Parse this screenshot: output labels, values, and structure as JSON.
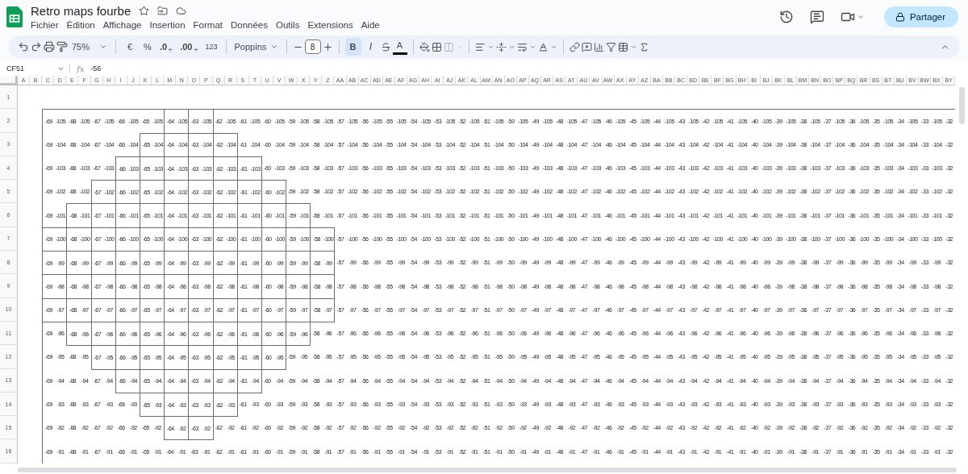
{
  "document": {
    "title": "Retro maps fourbe"
  },
  "menu": [
    "Fichier",
    "Édition",
    "Affichage",
    "Insertion",
    "Format",
    "Données",
    "Outils",
    "Extensions",
    "Aide"
  ],
  "share": {
    "label": "Partager"
  },
  "toolbar": {
    "zoom": "75%",
    "currency": "€",
    "percent": "%",
    "decrease_decimals": ".0",
    "increase_decimals": ".00",
    "number_format": "123",
    "font": "Poppins",
    "font_size": "8",
    "bold": {
      "label": "B",
      "selected": true
    },
    "italic": {
      "label": "I",
      "selected": false
    },
    "text_color": "A",
    "merge_disabled": true
  },
  "formula_bar": {
    "cell": "CF51",
    "fx": "fx",
    "formula": "-56"
  },
  "sheet": {
    "outer_border": true,
    "columns": [
      "A",
      "B",
      "C",
      "D",
      "E",
      "F",
      "G",
      "H",
      "I",
      "J",
      "K",
      "L",
      "M",
      "N",
      "O",
      "P",
      "Q",
      "R",
      "S",
      "T",
      "U",
      "V",
      "W",
      "X",
      "Y",
      "Z",
      "AA",
      "AB",
      "AC",
      "AD",
      "AE",
      "AF",
      "AG",
      "AH",
      "AI",
      "AJ",
      "AK",
      "AL",
      "AM",
      "AN",
      "AO",
      "AP",
      "AQ",
      "AR",
      "AS",
      "AT",
      "AU",
      "AV",
      "AW",
      "AX",
      "AY",
      "AZ",
      "BA",
      "BB",
      "BC",
      "BD",
      "BE",
      "BF",
      "BG",
      "BH",
      "BI",
      "BJ",
      "BK",
      "BL",
      "BM",
      "BN",
      "BO",
      "BP",
      "BQ",
      "BR",
      "BS",
      "BT",
      "BU",
      "BV",
      "BW",
      "BX",
      "BY"
    ],
    "rows": [
      {
        "label": "1"
      },
      {
        "label": "2",
        "cells": [
          "-69",
          "-105",
          "-68",
          "-105",
          "-67",
          "-105",
          "-66",
          "-105",
          "-65",
          "-105",
          "-64",
          "-105",
          "-63",
          "-105",
          "-62",
          "-105",
          "-61",
          "-105",
          "-60",
          "-105",
          "-59",
          "-105",
          "-58",
          "-105",
          "-57",
          "-105",
          "-56",
          "-105",
          "-55",
          "-105",
          "-54",
          "-105",
          "-53",
          "-105",
          "-52",
          "-105",
          "-51",
          "-105",
          "-50",
          "-105",
          "-49",
          "-105",
          "-48",
          "-105",
          "-47",
          "-105",
          "-46",
          "-105",
          "-45",
          "-105",
          "-44",
          "-105",
          "-43",
          "-105",
          "-42",
          "-105",
          "-41",
          "-105",
          "-40",
          "-105",
          "-39",
          "-105",
          "-38",
          "-105",
          "-37",
          "-105",
          "-36",
          "-105",
          "-35",
          "-105",
          "-34",
          "-105",
          "-33",
          "-105",
          "-32"
        ],
        "boxed": [
          false,
          false,
          false,
          false,
          false,
          true,
          true,
          false,
          false,
          false,
          false,
          false,
          false,
          false,
          false,
          false,
          false,
          false,
          false,
          false,
          false,
          false,
          false,
          false,
          false,
          false,
          false,
          false,
          false,
          false,
          false,
          false,
          false,
          false,
          false,
          false,
          false,
          false
        ]
      },
      {
        "label": "3",
        "cells": [
          "-69",
          "-104",
          "-68",
          "-104",
          "-67",
          "-104",
          "-66",
          "-104",
          "-65",
          "-104",
          "-64",
          "-104",
          "-63",
          "-104",
          "-62",
          "-104",
          "-61",
          "-104",
          "-60",
          "-104",
          "-59",
          "-104",
          "-58",
          "-104",
          "-57",
          "-104",
          "-56",
          "-104",
          "-55",
          "-104",
          "-54",
          "-104",
          "-53",
          "-104",
          "-52",
          "-104",
          "-51",
          "-104",
          "-50",
          "-104",
          "-49",
          "-104",
          "-48",
          "-104",
          "-47",
          "-104",
          "-46",
          "-104",
          "-45",
          "-104",
          "-44",
          "-104",
          "-43",
          "-104",
          "-42",
          "-104",
          "-41",
          "-104",
          "-40",
          "-104",
          "-39",
          "-104",
          "-38",
          "-104",
          "-37",
          "-104",
          "-36",
          "-104",
          "-35",
          "-104",
          "-34",
          "-104",
          "-33",
          "-104",
          "-32"
        ],
        "boxed": [
          false,
          false,
          false,
          false,
          true,
          true,
          true,
          true,
          false,
          false,
          false,
          false,
          false,
          false,
          false,
          false,
          false,
          false,
          false,
          false,
          false,
          false,
          false,
          false,
          false,
          false,
          false,
          false,
          false,
          false,
          false,
          false,
          false,
          false,
          false,
          false,
          false,
          false
        ]
      },
      {
        "label": "4",
        "cells": [
          "-69",
          "-103",
          "-68",
          "-103",
          "-67",
          "-103",
          "-66",
          "-103",
          "-65",
          "-103",
          "-64",
          "-103",
          "-63",
          "-103",
          "-62",
          "-103",
          "-61",
          "-103",
          "-60",
          "-103",
          "-59",
          "-103",
          "-58",
          "-103",
          "-57",
          "-103",
          "-56",
          "-103",
          "-55",
          "-103",
          "-54",
          "-103",
          "-53",
          "-103",
          "-52",
          "-103",
          "-51",
          "-103",
          "-50",
          "-103",
          "-49",
          "-103",
          "-48",
          "-103",
          "-47",
          "-103",
          "-46",
          "-103",
          "-45",
          "-103",
          "-44",
          "-103",
          "-43",
          "-103",
          "-42",
          "-103",
          "-41",
          "-103",
          "-40",
          "-103",
          "-39",
          "-103",
          "-38",
          "-103",
          "-37",
          "-103",
          "-36",
          "-103",
          "-35",
          "-103",
          "-34",
          "-103",
          "-33",
          "-103",
          "-32"
        ],
        "boxed": [
          false,
          false,
          false,
          true,
          true,
          true,
          true,
          true,
          true,
          false,
          false,
          false,
          false,
          false,
          false,
          false,
          false,
          false,
          false,
          false,
          false,
          false,
          false,
          false,
          false,
          false,
          false,
          false,
          false,
          false,
          false,
          false,
          false,
          false,
          false,
          false,
          false,
          false
        ]
      },
      {
        "label": "5",
        "cells": [
          "-69",
          "-102",
          "-68",
          "-102",
          "-67",
          "-102",
          "-66",
          "-102",
          "-65",
          "-102",
          "-64",
          "-102",
          "-63",
          "-102",
          "-62",
          "-102",
          "-61",
          "-102",
          "-60",
          "-102",
          "-59",
          "-102",
          "-58",
          "-102",
          "-57",
          "-102",
          "-56",
          "-102",
          "-55",
          "-102",
          "-54",
          "-102",
          "-53",
          "-102",
          "-52",
          "-102",
          "-51",
          "-102",
          "-50",
          "-102",
          "-49",
          "-102",
          "-48",
          "-102",
          "-47",
          "-102",
          "-46",
          "-102",
          "-45",
          "-102",
          "-44",
          "-102",
          "-43",
          "-102",
          "-42",
          "-102",
          "-41",
          "-102",
          "-40",
          "-102",
          "-39",
          "-102",
          "-38",
          "-102",
          "-37",
          "-102",
          "-36",
          "-102",
          "-35",
          "-102",
          "-34",
          "-102",
          "-33",
          "-102",
          "-32"
        ],
        "boxed": [
          false,
          false,
          true,
          true,
          true,
          true,
          true,
          true,
          true,
          true,
          false,
          false,
          false,
          false,
          false,
          false,
          false,
          false,
          false,
          false,
          false,
          false,
          false,
          false,
          false,
          false,
          false,
          false,
          false,
          false,
          false,
          false,
          false,
          false,
          false,
          false,
          false,
          false
        ]
      },
      {
        "label": "6",
        "cells": [
          "-69",
          "-101",
          "-68",
          "-101",
          "-67",
          "-101",
          "-66",
          "-101",
          "-65",
          "-101",
          "-64",
          "-101",
          "-63",
          "-101",
          "-62",
          "-101",
          "-61",
          "-101",
          "-60",
          "-101",
          "-59",
          "-101",
          "-58",
          "-101",
          "-57",
          "-101",
          "-56",
          "-101",
          "-55",
          "-101",
          "-54",
          "-101",
          "-53",
          "-101",
          "-52",
          "-101",
          "-51",
          "-101",
          "-50",
          "-101",
          "-49",
          "-101",
          "-48",
          "-101",
          "-47",
          "-101",
          "-46",
          "-101",
          "-45",
          "-101",
          "-44",
          "-101",
          "-43",
          "-101",
          "-42",
          "-101",
          "-41",
          "-101",
          "-40",
          "-101",
          "-39",
          "-101",
          "-38",
          "-101",
          "-37",
          "-101",
          "-36",
          "-101",
          "-35",
          "-101",
          "-34",
          "-101",
          "-33",
          "-101",
          "-32"
        ],
        "boxed": [
          false,
          true,
          true,
          true,
          true,
          true,
          true,
          true,
          true,
          true,
          true,
          false,
          false,
          false,
          false,
          false,
          false,
          false,
          false,
          false,
          false,
          false,
          false,
          false,
          false,
          false,
          false,
          false,
          false,
          false,
          false,
          false,
          false,
          false,
          false,
          false,
          false,
          false
        ]
      },
      {
        "label": "7",
        "cells": [
          "-69",
          "-100",
          "-68",
          "-100",
          "-67",
          "-100",
          "-66",
          "-100",
          "-65",
          "-100",
          "-64",
          "-100",
          "-63",
          "-100",
          "-62",
          "-100",
          "-61",
          "-100",
          "-60",
          "-100",
          "-59",
          "-100",
          "-58",
          "-100",
          "-57",
          "-100",
          "-56",
          "-100",
          "-55",
          "-100",
          "-54",
          "-100",
          "-53",
          "-100",
          "-52",
          "-100",
          "-51",
          "-100",
          "-50",
          "-100",
          "-49",
          "-100",
          "-48",
          "-100",
          "-47",
          "-100",
          "-46",
          "-100",
          "-45",
          "-100",
          "-44",
          "-100",
          "-43",
          "-100",
          "-42",
          "-100",
          "-41",
          "-100",
          "-40",
          "-100",
          "-39",
          "-100",
          "-38",
          "-100",
          "-37",
          "-100",
          "-36",
          "-100",
          "-35",
          "-100",
          "-34",
          "-100",
          "-33",
          "-100",
          "-32"
        ],
        "boxed": [
          true,
          true,
          true,
          true,
          true,
          true,
          true,
          true,
          true,
          true,
          true,
          true,
          false,
          false,
          false,
          false,
          false,
          false,
          false,
          false,
          false,
          false,
          false,
          false,
          false,
          false,
          false,
          false,
          false,
          false,
          false,
          false,
          false,
          false,
          false,
          false,
          false,
          false
        ]
      },
      {
        "label": "8",
        "cells": [
          "-69",
          "-99",
          "-68",
          "-99",
          "-67",
          "-99",
          "-66",
          "-99",
          "-65",
          "-99",
          "-64",
          "-99",
          "-63",
          "-99",
          "-62",
          "-99",
          "-61",
          "-99",
          "-60",
          "-99",
          "-59",
          "-99",
          "-58",
          "-99",
          "-57",
          "-99",
          "-56",
          "-99",
          "-55",
          "-99",
          "-54",
          "-99",
          "-53",
          "-99",
          "-52",
          "-99",
          "-51",
          "-99",
          "-50",
          "-99",
          "-49",
          "-99",
          "-48",
          "-99",
          "-47",
          "-99",
          "-46",
          "-99",
          "-45",
          "-99",
          "-44",
          "-99",
          "-43",
          "-99",
          "-42",
          "-99",
          "-41",
          "-99",
          "-40",
          "-99",
          "-39",
          "-99",
          "-38",
          "-99",
          "-37",
          "-99",
          "-36",
          "-99",
          "-35",
          "-99",
          "-34",
          "-99",
          "-33",
          "-99",
          "-32"
        ],
        "boxed": [
          true,
          true,
          true,
          true,
          true,
          true,
          true,
          true,
          true,
          true,
          true,
          true,
          false,
          false,
          false,
          false,
          false,
          false,
          false,
          false,
          false,
          false,
          false,
          false,
          false,
          false,
          false,
          false,
          false,
          false,
          false,
          false,
          false,
          false,
          false,
          false,
          false,
          false
        ]
      },
      {
        "label": "9",
        "cells": [
          "-69",
          "-98",
          "-68",
          "-98",
          "-67",
          "-98",
          "-66",
          "-98",
          "-65",
          "-98",
          "-64",
          "-98",
          "-63",
          "-98",
          "-62",
          "-98",
          "-61",
          "-98",
          "-60",
          "-98",
          "-59",
          "-98",
          "-58",
          "-98",
          "-57",
          "-98",
          "-56",
          "-98",
          "-55",
          "-98",
          "-54",
          "-98",
          "-53",
          "-98",
          "-52",
          "-98",
          "-51",
          "-98",
          "-50",
          "-98",
          "-49",
          "-98",
          "-48",
          "-98",
          "-47",
          "-98",
          "-46",
          "-98",
          "-45",
          "-98",
          "-44",
          "-98",
          "-43",
          "-98",
          "-42",
          "-98",
          "-41",
          "-98",
          "-40",
          "-98",
          "-39",
          "-98",
          "-38",
          "-98",
          "-37",
          "-98",
          "-36",
          "-98",
          "-35",
          "-98",
          "-34",
          "-98",
          "-33",
          "-98",
          "-32"
        ],
        "boxed": [
          true,
          true,
          true,
          true,
          true,
          true,
          true,
          true,
          true,
          true,
          true,
          true,
          false,
          false,
          false,
          false,
          false,
          false,
          false,
          false,
          false,
          false,
          false,
          false,
          false,
          false,
          false,
          false,
          false,
          false,
          false,
          false,
          false,
          false,
          false,
          false,
          false,
          false
        ]
      },
      {
        "label": "10",
        "cells": [
          "-69",
          "-97",
          "-68",
          "-97",
          "-67",
          "-97",
          "-66",
          "-97",
          "-65",
          "-97",
          "-64",
          "-97",
          "-63",
          "-97",
          "-62",
          "-97",
          "-61",
          "-97",
          "-60",
          "-97",
          "-59",
          "-97",
          "-58",
          "-97",
          "-57",
          "-97",
          "-56",
          "-97",
          "-55",
          "-97",
          "-54",
          "-97",
          "-53",
          "-97",
          "-52",
          "-97",
          "-51",
          "-97",
          "-50",
          "-97",
          "-49",
          "-97",
          "-48",
          "-97",
          "-47",
          "-97",
          "-46",
          "-97",
          "-45",
          "-97",
          "-44",
          "-97",
          "-43",
          "-97",
          "-42",
          "-97",
          "-41",
          "-97",
          "-40",
          "-97",
          "-39",
          "-97",
          "-38",
          "-97",
          "-37",
          "-97",
          "-36",
          "-97",
          "-35",
          "-97",
          "-34",
          "-97",
          "-33",
          "-97",
          "-32"
        ],
        "boxed": [
          true,
          true,
          true,
          true,
          true,
          true,
          true,
          true,
          true,
          true,
          true,
          true,
          false,
          false,
          false,
          false,
          false,
          false,
          false,
          false,
          false,
          false,
          false,
          false,
          false,
          false,
          false,
          false,
          false,
          false,
          false,
          false,
          false,
          false,
          false,
          false,
          false,
          false
        ]
      },
      {
        "label": "11",
        "cells": [
          "-69",
          "-96",
          "-68",
          "-96",
          "-67",
          "-96",
          "-66",
          "-96",
          "-65",
          "-96",
          "-64",
          "-96",
          "-63",
          "-96",
          "-62",
          "-96",
          "-61",
          "-96",
          "-60",
          "-96",
          "-59",
          "-96",
          "-58",
          "-96",
          "-57",
          "-96",
          "-56",
          "-96",
          "-55",
          "-96",
          "-54",
          "-96",
          "-53",
          "-96",
          "-52",
          "-96",
          "-51",
          "-96",
          "-50",
          "-96",
          "-49",
          "-96",
          "-48",
          "-96",
          "-47",
          "-96",
          "-46",
          "-96",
          "-45",
          "-96",
          "-44",
          "-96",
          "-43",
          "-96",
          "-42",
          "-96",
          "-41",
          "-96",
          "-40",
          "-96",
          "-39",
          "-96",
          "-38",
          "-96",
          "-37",
          "-96",
          "-36",
          "-96",
          "-35",
          "-96",
          "-34",
          "-96",
          "-33",
          "-96",
          "-32"
        ],
        "boxed": [
          false,
          true,
          true,
          true,
          true,
          true,
          true,
          true,
          true,
          true,
          true,
          false,
          false,
          false,
          false,
          false,
          false,
          false,
          false,
          false,
          false,
          false,
          false,
          false,
          false,
          false,
          false,
          false,
          false,
          false,
          false,
          false,
          false,
          false,
          false,
          false,
          false,
          false
        ]
      },
      {
        "label": "12",
        "cells": [
          "-69",
          "-95",
          "-68",
          "-95",
          "-67",
          "-95",
          "-66",
          "-95",
          "-65",
          "-95",
          "-64",
          "-95",
          "-63",
          "-95",
          "-62",
          "-95",
          "-61",
          "-95",
          "-60",
          "-95",
          "-59",
          "-95",
          "-58",
          "-95",
          "-57",
          "-95",
          "-56",
          "-95",
          "-55",
          "-95",
          "-54",
          "-95",
          "-53",
          "-95",
          "-52",
          "-95",
          "-51",
          "-95",
          "-50",
          "-95",
          "-49",
          "-95",
          "-48",
          "-95",
          "-47",
          "-95",
          "-46",
          "-95",
          "-45",
          "-95",
          "-44",
          "-95",
          "-43",
          "-95",
          "-42",
          "-95",
          "-41",
          "-95",
          "-40",
          "-95",
          "-39",
          "-95",
          "-38",
          "-95",
          "-37",
          "-95",
          "-36",
          "-95",
          "-35",
          "-95",
          "-34",
          "-95",
          "-33",
          "-95",
          "-32"
        ],
        "boxed": [
          false,
          false,
          true,
          true,
          true,
          true,
          true,
          true,
          true,
          true,
          false,
          false,
          false,
          false,
          false,
          false,
          false,
          false,
          false,
          false,
          false,
          false,
          false,
          false,
          false,
          false,
          false,
          false,
          false,
          false,
          false,
          false,
          false,
          false,
          false,
          false,
          false,
          false
        ]
      },
      {
        "label": "13",
        "cells": [
          "-69",
          "-94",
          "-68",
          "-94",
          "-67",
          "-94",
          "-66",
          "-94",
          "-65",
          "-94",
          "-64",
          "-94",
          "-63",
          "-94",
          "-62",
          "-94",
          "-61",
          "-94",
          "-60",
          "-94",
          "-59",
          "-94",
          "-58",
          "-94",
          "-57",
          "-94",
          "-56",
          "-94",
          "-55",
          "-94",
          "-54",
          "-94",
          "-53",
          "-94",
          "-52",
          "-94",
          "-51",
          "-94",
          "-50",
          "-94",
          "-49",
          "-94",
          "-48",
          "-94",
          "-47",
          "-94",
          "-46",
          "-94",
          "-45",
          "-94",
          "-44",
          "-94",
          "-43",
          "-94",
          "-42",
          "-94",
          "-41",
          "-94",
          "-40",
          "-94",
          "-39",
          "-94",
          "-38",
          "-94",
          "-37",
          "-94",
          "-36",
          "-94",
          "-35",
          "-94",
          "-34",
          "-94",
          "-33",
          "-94",
          "-32"
        ],
        "boxed": [
          false,
          false,
          false,
          true,
          true,
          true,
          true,
          true,
          true,
          false,
          false,
          false,
          false,
          false,
          false,
          false,
          false,
          false,
          false,
          false,
          false,
          false,
          false,
          false,
          false,
          false,
          false,
          false,
          false,
          false,
          false,
          false,
          false,
          false,
          false,
          false,
          false,
          false
        ]
      },
      {
        "label": "14",
        "cells": [
          "-69",
          "-93",
          "-68",
          "-93",
          "-67",
          "-93",
          "-66",
          "-93",
          "-65",
          "-93",
          "-64",
          "-93",
          "-63",
          "-93",
          "-62",
          "-93",
          "-61",
          "-93",
          "-60",
          "-93",
          "-59",
          "-93",
          "-58",
          "-93",
          "-57",
          "-93",
          "-56",
          "-93",
          "-55",
          "-93",
          "-54",
          "-93",
          "-53",
          "-93",
          "-52",
          "-93",
          "-51",
          "-93",
          "-50",
          "-93",
          "-49",
          "-93",
          "-48",
          "-93",
          "-47",
          "-93",
          "-46",
          "-93",
          "-45",
          "-93",
          "-44",
          "-93",
          "-43",
          "-93",
          "-42",
          "-93",
          "-41",
          "-93",
          "-40",
          "-93",
          "-39",
          "-93",
          "-38",
          "-93",
          "-37",
          "-93",
          "-36",
          "-93",
          "-35",
          "-93",
          "-34",
          "-93",
          "-33",
          "-93",
          "-32"
        ],
        "boxed": [
          false,
          false,
          false,
          false,
          true,
          true,
          true,
          true,
          false,
          false,
          false,
          false,
          false,
          false,
          false,
          false,
          false,
          false,
          false,
          false,
          false,
          false,
          false,
          false,
          false,
          false,
          false,
          false,
          false,
          false,
          false,
          false,
          false,
          false,
          false,
          false,
          false,
          false
        ]
      },
      {
        "label": "15",
        "cells": [
          "-69",
          "-92",
          "-68",
          "-92",
          "-67",
          "-92",
          "-66",
          "-92",
          "-65",
          "-92",
          "-64",
          "-92",
          "-63",
          "-92",
          "-62",
          "-92",
          "-61",
          "-92",
          "-60",
          "-92",
          "-59",
          "-92",
          "-58",
          "-92",
          "-57",
          "-92",
          "-56",
          "-92",
          "-55",
          "-92",
          "-54",
          "-92",
          "-53",
          "-92",
          "-52",
          "-92",
          "-51",
          "-92",
          "-50",
          "-92",
          "-49",
          "-92",
          "-48",
          "-92",
          "-47",
          "-92",
          "-46",
          "-92",
          "-45",
          "-92",
          "-44",
          "-92",
          "-43",
          "-92",
          "-42",
          "-92",
          "-41",
          "-92",
          "-40",
          "-92",
          "-39",
          "-92",
          "-38",
          "-92",
          "-37",
          "-92",
          "-36",
          "-92",
          "-35",
          "-92",
          "-34",
          "-92",
          "-33",
          "-92",
          "-32"
        ],
        "boxed": [
          false,
          false,
          false,
          false,
          false,
          true,
          true,
          false,
          false,
          false,
          false,
          false,
          false,
          false,
          false,
          false,
          false,
          false,
          false,
          false,
          false,
          false,
          false,
          false,
          false,
          false,
          false,
          false,
          false,
          false,
          false,
          false,
          false,
          false,
          false,
          false,
          false,
          false
        ]
      },
      {
        "label": "16",
        "cells": [
          "-69",
          "-91",
          "-68",
          "-91",
          "-67",
          "-91",
          "-66",
          "-91",
          "-65",
          "-91",
          "-64",
          "-91",
          "-63",
          "-91",
          "-62",
          "-91",
          "-61",
          "-91",
          "-60",
          "-91",
          "-59",
          "-91",
          "-58",
          "-91",
          "-57",
          "-91",
          "-56",
          "-91",
          "-55",
          "-91",
          "-54",
          "-91",
          "-53",
          "-91",
          "-52",
          "-91",
          "-51",
          "-91",
          "-50",
          "-91",
          "-49",
          "-91",
          "-48",
          "-91",
          "-47",
          "-91",
          "-46",
          "-91",
          "-45",
          "-91",
          "-44",
          "-91",
          "-43",
          "-91",
          "-42",
          "-91",
          "-41",
          "-91",
          "-40",
          "-91",
          "-39",
          "-91",
          "-38",
          "-91",
          "-37",
          "-91",
          "-36",
          "-91",
          "-35",
          "-91",
          "-34",
          "-91",
          "-33",
          "-91",
          "-32"
        ],
        "boxed": [
          false,
          false,
          false,
          false,
          false,
          false,
          false,
          false,
          false,
          false,
          false,
          false,
          false,
          false,
          false,
          false,
          false,
          false,
          false,
          false,
          false,
          false,
          false,
          false,
          false,
          false,
          false,
          false,
          false,
          false,
          false,
          false,
          false,
          false,
          false,
          false,
          false,
          false
        ]
      }
    ]
  }
}
